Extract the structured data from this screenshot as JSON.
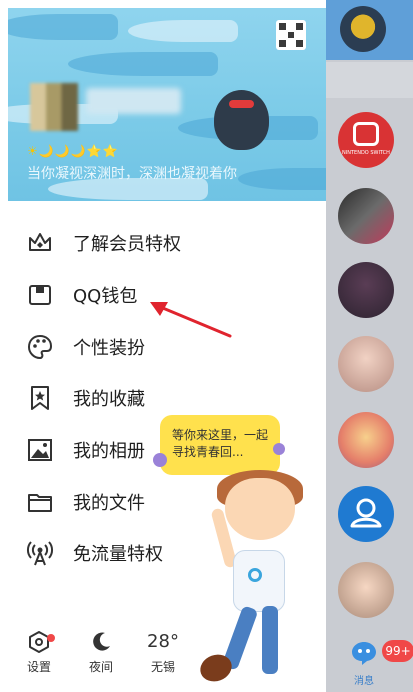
{
  "profile": {
    "level_icons": "☀🌙🌙🌙⭐⭐",
    "signature": "当你凝视深渊时，深渊也凝视着你"
  },
  "menu": [
    {
      "label": "了解会员特权",
      "icon": "crown-icon"
    },
    {
      "label": "QQ钱包",
      "icon": "wallet-icon"
    },
    {
      "label": "个性装扮",
      "icon": "palette-icon"
    },
    {
      "label": "我的收藏",
      "icon": "bookmark-star-icon"
    },
    {
      "label": "我的相册",
      "icon": "image-icon"
    },
    {
      "label": "我的文件",
      "icon": "folder-icon"
    },
    {
      "label": "免流量特权",
      "icon": "signal-tower-icon"
    }
  ],
  "bottom": {
    "settings_label": "设置",
    "night_label": "夜间",
    "temperature": "28°",
    "city": "无锡"
  },
  "bubble_text": "等你来这里，一起寻找青春回...",
  "right_panel": {
    "switch_text": "NINTENDO SWITCH",
    "messages_label": "消息",
    "badge": "99+"
  },
  "colors": {
    "banner": "#7ccbe8",
    "arrow": "#e0242e",
    "badge": "#f04848",
    "bubble": "#ffe14d"
  }
}
